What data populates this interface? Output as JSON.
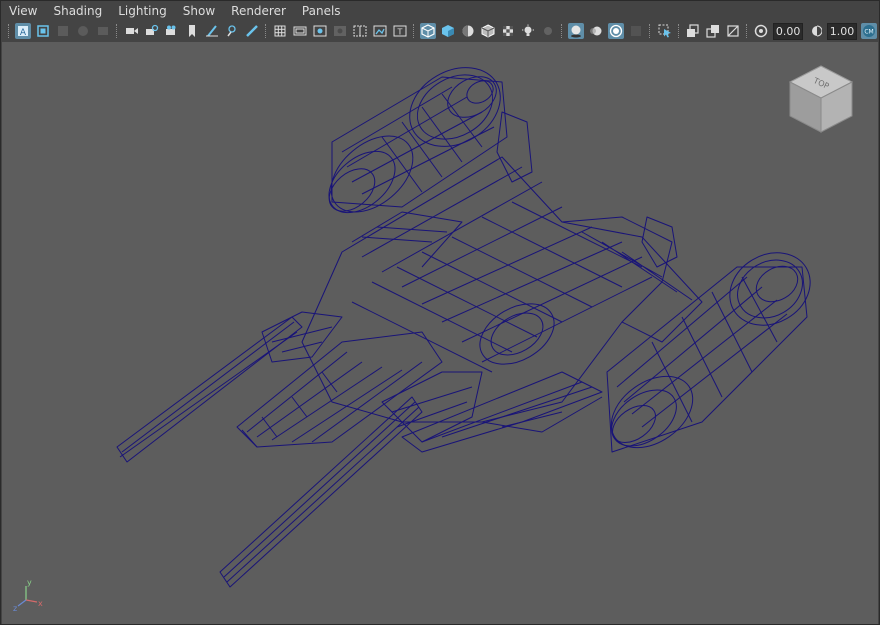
{
  "menu": [
    "View",
    "Shading",
    "Lighting",
    "Show",
    "Renderer",
    "Panels"
  ],
  "toolbar": {
    "groups": [
      [
        "select-camera-icon",
        "camera-attributes-icon",
        "bookmarks-icon",
        "image-plane-icon",
        "2d-pan-zoom-icon"
      ],
      [
        "camera-icon",
        "lock-camera-icon",
        "camera-video-icon",
        "bookmark-icon",
        "grease-pencil-icon",
        "pen-icon",
        "paint-icon"
      ],
      [
        "grid-icon",
        "film-gate-icon",
        "resolution-gate-icon",
        "gate-mask-icon",
        "field-chart-icon",
        "safe-action-icon",
        "safe-title-icon"
      ],
      [
        "wireframe-icon",
        "smooth-shade-icon",
        "default-material-icon",
        "wireframe-on-shaded-icon",
        "textured-icon",
        "use-all-lights-icon",
        "shadows-icon"
      ],
      [
        "screen-space-ao-icon",
        "motion-blur-icon",
        "anti-aliasing-icon",
        "depth-of-field-icon"
      ],
      [
        "isolate-select-icon"
      ],
      [
        "x-ray-icon",
        "x-ray-active-icon",
        "x-ray-joints-icon"
      ],
      [
        "exposure-icon"
      ]
    ],
    "exposure_value": "0.00",
    "gamma_value": "1.00",
    "color_management_label": "CM"
  },
  "viewport": {
    "viewcube_label": "TOP",
    "axis": {
      "x": "x",
      "y": "y",
      "z": "z"
    },
    "wire_color": "#16107a",
    "background": "#5d5d5d"
  }
}
